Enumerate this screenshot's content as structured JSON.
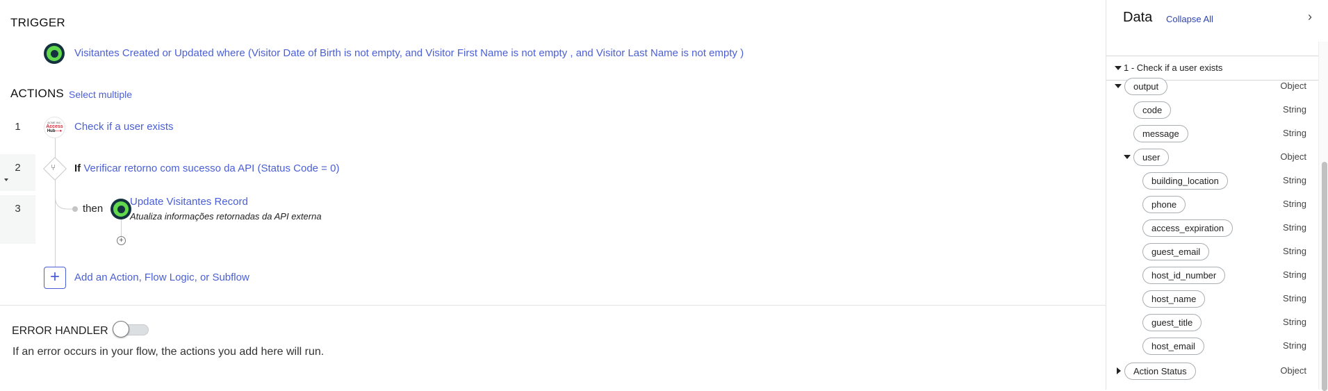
{
  "trigger": {
    "heading": "TRIGGER",
    "icon": "record-trigger-icon",
    "description": "Visitantes Created or Updated where (Visitor Date of Birth is not empty, and Visitor First Name is not empty , and Visitor Last Name is not empty )"
  },
  "actions": {
    "heading": "ACTIONS",
    "select_multiple": "Select multiple",
    "steps": [
      {
        "number": "1",
        "label": "Check if a user exists",
        "logo": {
          "line1": "ACME INC.",
          "line2": "Access",
          "line3": "Hub"
        }
      },
      {
        "number": "2",
        "keyword": "If",
        "label": "Verificar retorno com sucesso da API (Status Code = 0)"
      },
      {
        "number": "3",
        "branch": "then",
        "label": "Update Visitantes Record",
        "annotation": "Atualiza informações retornadas da API externa"
      }
    ],
    "add_label": "Add an Action, Flow Logic, or Subflow"
  },
  "error_handler": {
    "heading": "ERROR HANDLER",
    "enabled": false,
    "description": "If an error occurs in your flow, the actions you add here will run."
  },
  "data_panel": {
    "title": "Data",
    "collapse_all": "Collapse All",
    "section": "1 - Check if a user exists",
    "tree": {
      "output": {
        "name": "output",
        "type": "Object"
      },
      "code": {
        "name": "code",
        "type": "String"
      },
      "message": {
        "name": "message",
        "type": "String"
      },
      "user": {
        "name": "user",
        "type": "Object"
      },
      "user_fields": [
        {
          "name": "building_location",
          "type": "String"
        },
        {
          "name": "phone",
          "type": "String"
        },
        {
          "name": "access_expiration",
          "type": "String"
        },
        {
          "name": "guest_email",
          "type": "String"
        },
        {
          "name": "host_id_number",
          "type": "String"
        },
        {
          "name": "host_name",
          "type": "String"
        },
        {
          "name": "guest_title",
          "type": "String"
        },
        {
          "name": "host_email",
          "type": "String"
        }
      ],
      "action_status": {
        "name": "Action Status",
        "type": "Object"
      }
    }
  },
  "colors": {
    "link": "#4a5fd6",
    "accent_green": "#62d84e",
    "icon_dark": "#14313f"
  }
}
